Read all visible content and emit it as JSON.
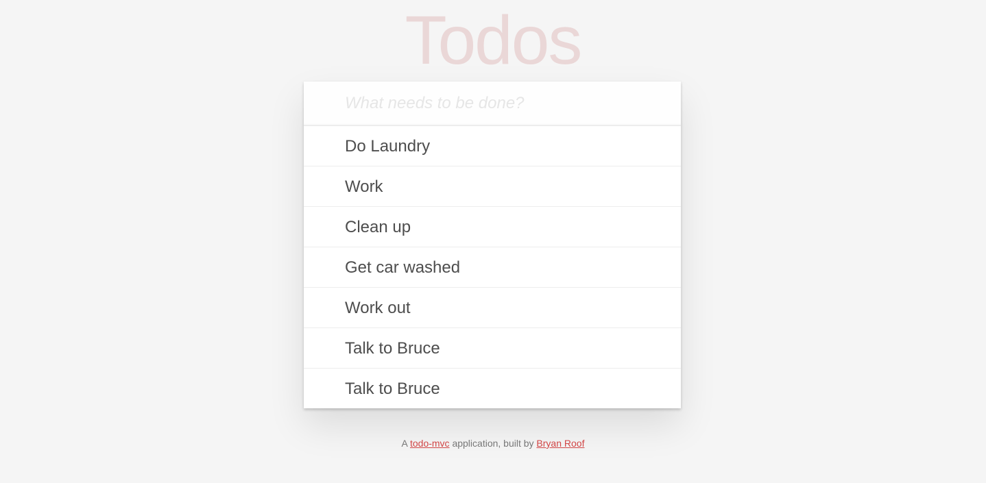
{
  "header": {
    "title": "Todos"
  },
  "new_todo": {
    "value": "",
    "placeholder": "What needs to be done?"
  },
  "todos": [
    {
      "label": "Do Laundry"
    },
    {
      "label": "Work"
    },
    {
      "label": "Clean up"
    },
    {
      "label": "Get car washed"
    },
    {
      "label": "Work out"
    },
    {
      "label": "Talk to Bruce"
    },
    {
      "label": "Talk to Bruce"
    }
  ],
  "footer": {
    "prefix": "A",
    "link1_text": "todo-mvc",
    "middle": "application, built by",
    "link2_text": "Bryan Roof"
  },
  "colors": {
    "background": "#f5f5f5",
    "title": "#eaccd0",
    "link": "#d14545",
    "text": "#4d4d4d"
  }
}
